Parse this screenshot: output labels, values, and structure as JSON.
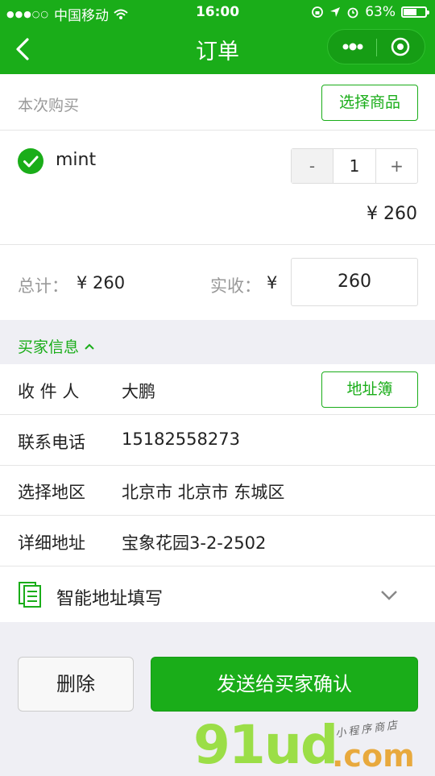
{
  "status_bar": {
    "carrier": "中国移动",
    "time": "16:00",
    "battery": "63%",
    "battery_level": 0.63
  },
  "nav": {
    "title": "订单"
  },
  "purchase": {
    "section_label": "本次购买",
    "select_goods_label": "选择商品",
    "item": {
      "name": "mint",
      "quantity": "1",
      "minus_label": "-",
      "plus_label": "+",
      "price": "¥ 260"
    }
  },
  "totals": {
    "total_label": "总计：",
    "total_value": "¥ 260",
    "received_label": "实收：",
    "currency": "¥",
    "received_value": "260"
  },
  "buyer": {
    "section_label": "买家信息",
    "recipient_label": "收 件 人",
    "recipient_value": "大鹏",
    "address_book_label": "地址簿",
    "phone_label": "联系电话",
    "phone_value": "15182558273",
    "region_label": "选择地区",
    "region_value": "北京市 北京市 东城区",
    "address_label": "详细地址",
    "address_value": "宝象花园3-2-2502",
    "smart_fill_label": "智能地址填写"
  },
  "actions": {
    "delete_label": "删除",
    "send_label": "发送给买家确认"
  },
  "watermark": {
    "brand_main": "91ud",
    "brand_suffix": ".com",
    "brand_tagline": "小程序商店"
  },
  "colors": {
    "brand_green": "#1aad19",
    "background": "#efeff4"
  }
}
